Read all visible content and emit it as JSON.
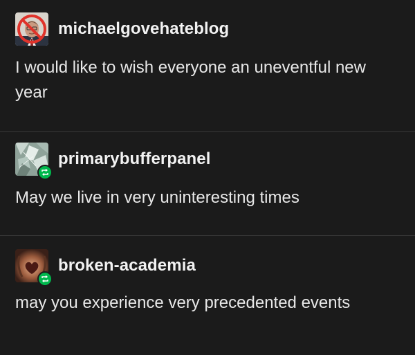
{
  "posts": [
    {
      "username": "michaelgovehateblog",
      "text": "I would like to wish everyone an uneventful new year",
      "avatar_icon": "crossed-out-portrait-icon",
      "reblog": false
    },
    {
      "username": "primarybufferpanel",
      "text": "May we live in very uninteresting times",
      "avatar_icon": "pale-crystal-avatar-icon",
      "reblog": true
    },
    {
      "username": "broken-academia",
      "text": "may you experience very precedented events",
      "avatar_icon": "heart-candle-avatar-icon",
      "reblog": true
    }
  ],
  "colors": {
    "background": "#1b1b1b",
    "text": "#e8e8e8",
    "divider": "#3a3a3a",
    "reblog_badge": "#00b84d",
    "prohibition_red": "#e0332b"
  }
}
